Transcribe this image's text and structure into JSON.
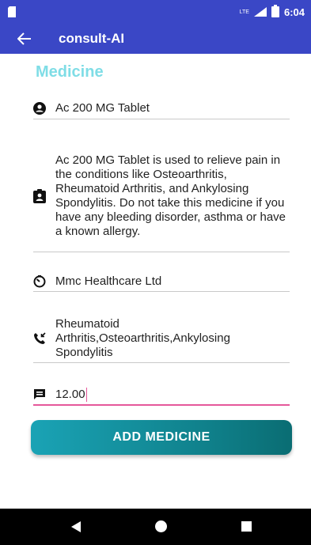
{
  "status_bar": {
    "time": "6:04",
    "network": "LTE"
  },
  "app_bar": {
    "title": "consult-AI"
  },
  "form": {
    "section_title": "Medicine",
    "name": "Ac 200 MG Tablet",
    "description": "Ac 200 MG Tablet is used to relieve pain in the conditions like Osteoarthritis, Rheumatoid Arthritis, and Ankylosing Spondylitis. Do not take this medicine if you have any bleeding disorder, asthma or have a known allergy.",
    "manufacturer": "Mmc Healthcare Ltd",
    "conditions": "Rheumatoid Arthritis,Osteoarthritis,Ankylosing Spondylitis",
    "price": "12.00",
    "submit_label": "ADD  MEDICINE"
  },
  "colors": {
    "primary": "#3a47c6",
    "accent": "#7fdde6",
    "button": "#1aa3b5",
    "focus_underline": "#e5589a"
  }
}
